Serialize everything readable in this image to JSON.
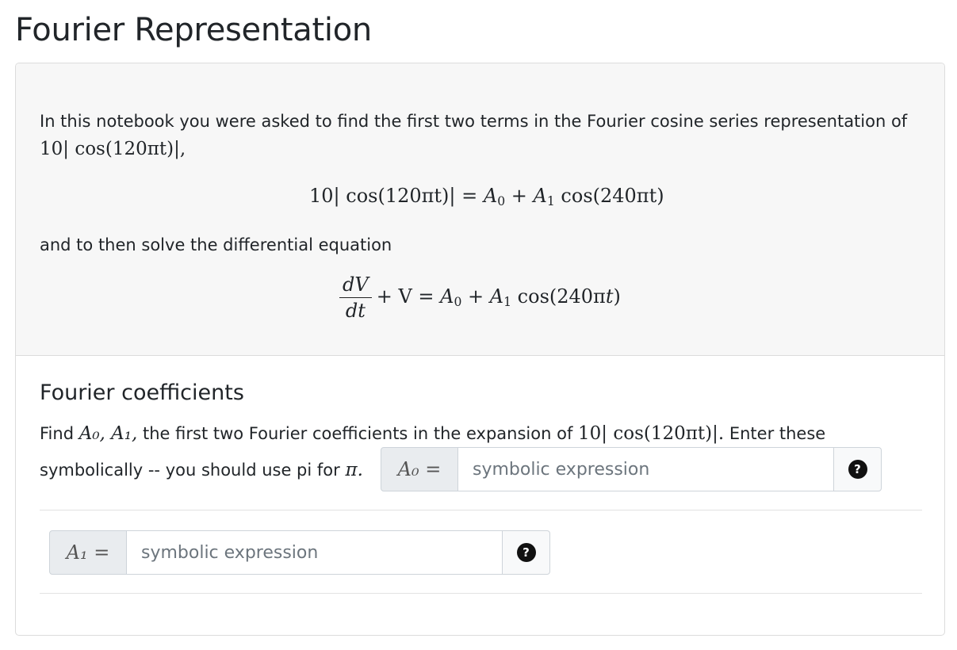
{
  "page_title": "Fourier Representation",
  "intro": {
    "line1": "In this notebook you were asked to find the first two terms in the Fourier cosine series representation of",
    "expr_inline": "10| cos(120πt)|,",
    "series_eq_lhs": "10| cos(120πt)| = ",
    "series_eq_rhs_prefix": "A",
    "series_eq_rhs_cos": "cos(240πt)",
    "line2": "and to then solve the differential equation",
    "de_num": "dV",
    "de_den": "dt",
    "de_rest": "+ V = "
  },
  "section": {
    "title": "Fourier coefficients",
    "text_part1": "Find",
    "text_coeffs": "A₀, A₁,",
    "text_part2": "the first two Fourier coefficients in the expansion of",
    "text_expr": "10| cos(120πt)|.",
    "text_part3": "Enter these",
    "text_line2": "symbolically -- you should use pi for",
    "text_pi": "π."
  },
  "inputs": {
    "a0_label": "A₀ =",
    "a1_label": "A₁ =",
    "a0_placeholder": "symbolic expression",
    "a1_placeholder": "symbolic expression",
    "a0_value": "",
    "a1_value": "",
    "help_glyph": "?"
  },
  "icons": {
    "help": "question-circle-icon"
  }
}
